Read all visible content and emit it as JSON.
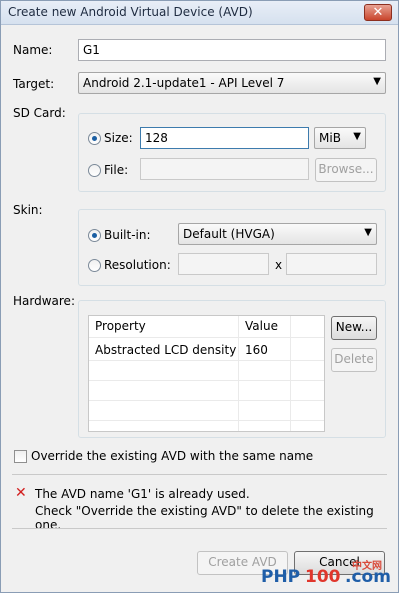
{
  "window": {
    "title": "Create new Android Virtual Device (AVD)",
    "close_label": "✕"
  },
  "name": {
    "label": "Name:",
    "value": "G1"
  },
  "target": {
    "label": "Target:",
    "value": "Android 2.1-update1 - API Level 7"
  },
  "sdcard": {
    "label": "SD Card:",
    "size_label": "Size:",
    "size_value": "128",
    "unit": "MiB",
    "file_label": "File:",
    "file_value": "",
    "browse_label": "Browse..."
  },
  "skin": {
    "label": "Skin:",
    "builtin_label": "Built-in:",
    "builtin_value": "Default (HVGA)",
    "resolution_label": "Resolution:",
    "x_label": "x"
  },
  "hardware": {
    "label": "Hardware:",
    "columns": [
      "Property",
      "Value"
    ],
    "rows": [
      {
        "property": "Abstracted LCD density",
        "value": "160"
      }
    ],
    "new_label": "New...",
    "delete_label": "Delete"
  },
  "override": {
    "label": "Override the existing AVD with the same name"
  },
  "error": {
    "line1": "The AVD name 'G1' is already used.",
    "line2": "Check \"Override the existing AVD\" to delete the existing one."
  },
  "buttons": {
    "create": "Create AVD",
    "cancel": "Cancel"
  },
  "watermark": {
    "left": "PHP",
    "right": "100",
    "suffix": ".com",
    "cn": "中文网"
  }
}
